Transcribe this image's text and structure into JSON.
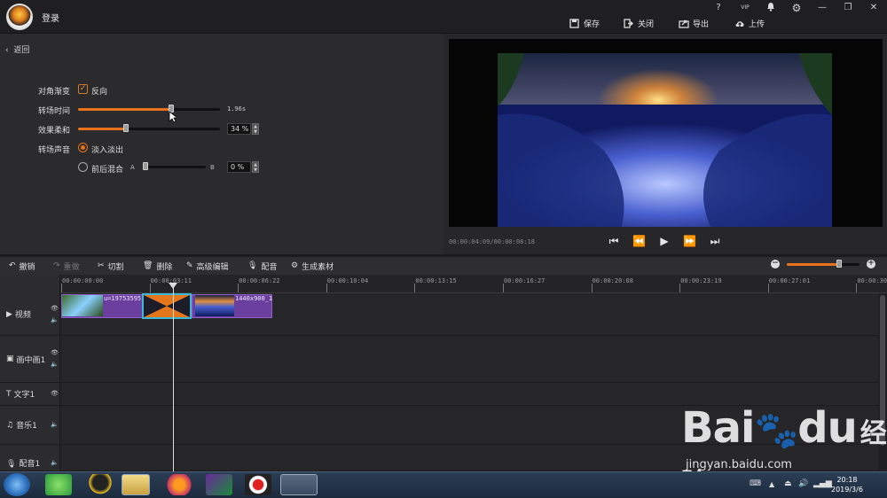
{
  "titlebar": {
    "app_title": "登录",
    "help": "?",
    "vip": "VIP",
    "actions": {
      "save": "保存",
      "close": "关闭",
      "export": "导出",
      "upload": "上传"
    }
  },
  "panel": {
    "back": "返回",
    "diag_label": "对角渐变",
    "reverse": "反向",
    "reverse_checked": true,
    "duration_label": "转场时间",
    "duration_value": "1.96s",
    "duration_fraction": 0.76,
    "softness_label": "效果柔和",
    "softness_value": "34 %",
    "softness_fraction": 0.34,
    "sound_label": "转场声音",
    "fade": "淡入淡出",
    "mix": "前后混合",
    "mix_a": "A",
    "mix_b": "B",
    "mix_value": "0 %"
  },
  "preview": {
    "timecode": "00:00:04:09/00:00:08:18"
  },
  "toolbar": {
    "undo": "撤销",
    "redo": "重做",
    "cut": "切割",
    "delete": "删除",
    "advanced": "高级编辑",
    "dub": "配音",
    "generate": "生成素材"
  },
  "zoom_fraction": 0.72,
  "ruler": [
    "00:00:00:00",
    "00:00:03:11",
    "00:00:06:22",
    "00:00:10:04",
    "00:00:13:15",
    "00:00:16:27",
    "00:00:20:08",
    "00:00:23:19",
    "00:00:27:01",
    "00:00:30:"
  ],
  "tracks": {
    "video": "视频",
    "pip": "画中画1",
    "text": "文字1",
    "music": "音乐1",
    "voice": "配音1"
  },
  "clips": {
    "clip1": "u=19753595",
    "clip2": "1440x900_1"
  },
  "clock": {
    "time": "20:18",
    "date": "2019/3/6"
  },
  "watermark": {
    "brand": "Bai",
    "brand2": "du",
    "cn": "经验",
    "url": "jingyan.baidu.com"
  }
}
